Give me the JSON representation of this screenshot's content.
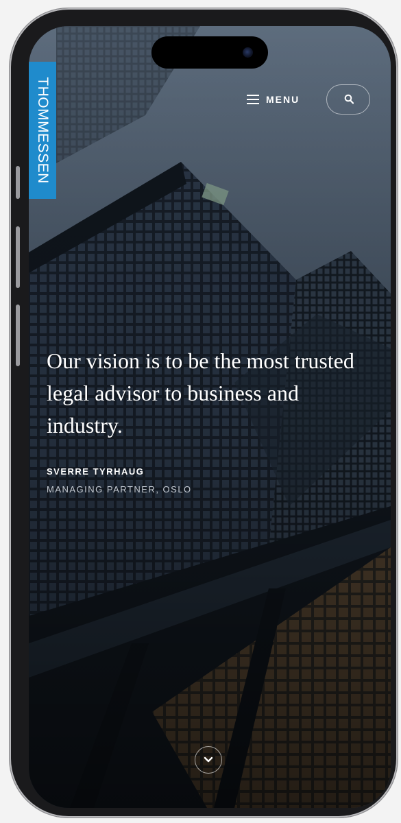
{
  "brand": {
    "logo_text": "THOMMESSEN",
    "accent": "#1f8bcc"
  },
  "header": {
    "menu_label": "MENU",
    "menu_icon": "hamburger-icon",
    "search_icon": "search-icon"
  },
  "hero": {
    "quote": "Our vision is to be the most trusted legal advisor to business and industry.",
    "author": "SVERRE TYRHAUG",
    "role": "MANAGING PARTNER, OSLO",
    "scroll_icon": "chevron-down-icon"
  }
}
